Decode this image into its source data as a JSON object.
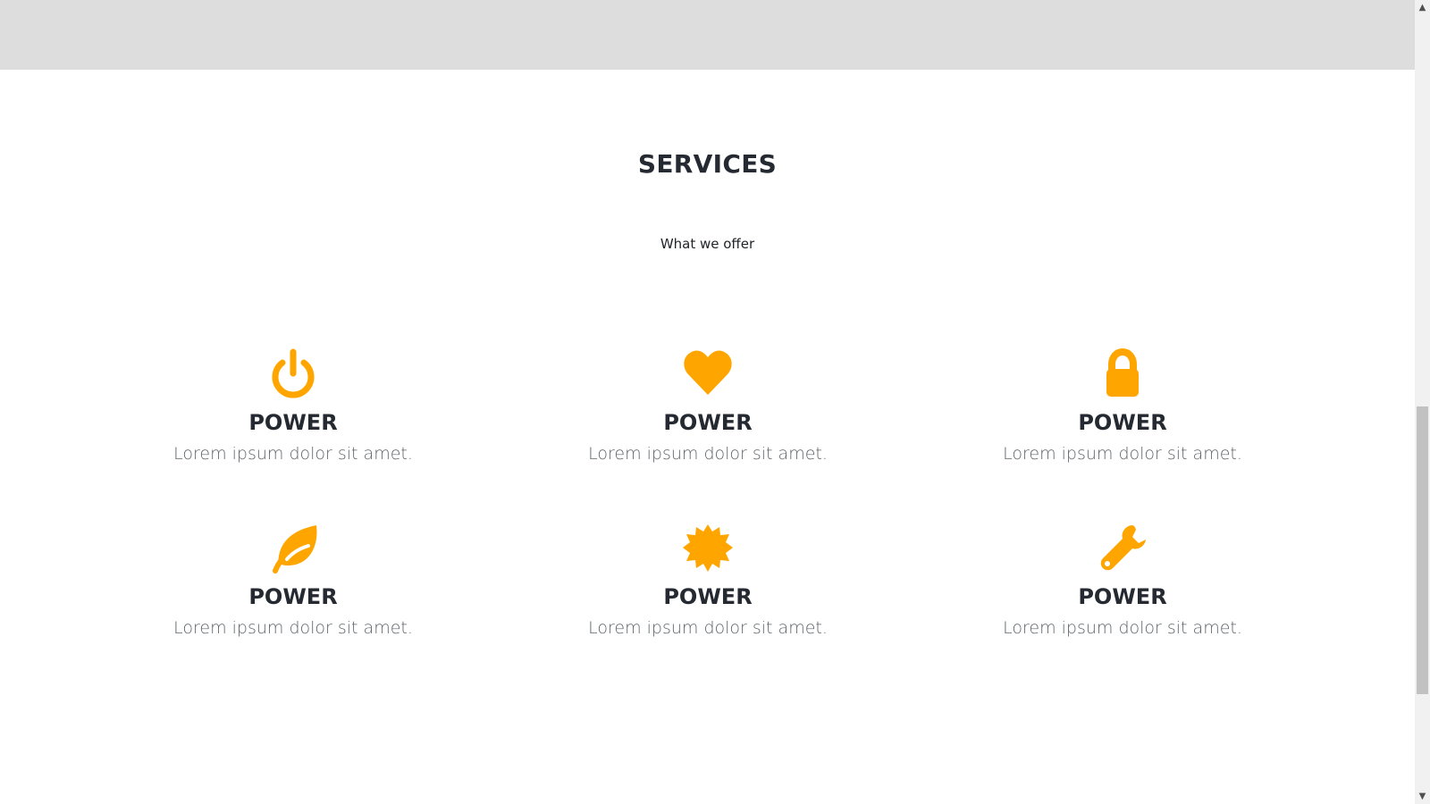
{
  "services": {
    "title": "SERVICES",
    "subtitle": "What we offer",
    "items": [
      {
        "icon": "power-icon",
        "title": "POWER",
        "text": "Lorem ipsum dolor sit amet."
      },
      {
        "icon": "heart-icon",
        "title": "POWER",
        "text": "Lorem ipsum dolor sit amet."
      },
      {
        "icon": "lock-icon",
        "title": "POWER",
        "text": "Lorem ipsum dolor sit amet."
      },
      {
        "icon": "leaf-icon",
        "title": "POWER",
        "text": "Lorem ipsum dolor sit amet."
      },
      {
        "icon": "certificate-icon",
        "title": "POWER",
        "text": "Lorem ipsum dolor sit amet."
      },
      {
        "icon": "wrench-icon",
        "title": "POWER",
        "text": "Lorem ipsum dolor sit amet."
      }
    ]
  },
  "colors": {
    "accent": "#ffa500",
    "top_band": "#dddddd",
    "heading": "#252a32",
    "body_text": "#5e6469"
  },
  "scrollbar": {
    "position_fraction": 0.58
  }
}
